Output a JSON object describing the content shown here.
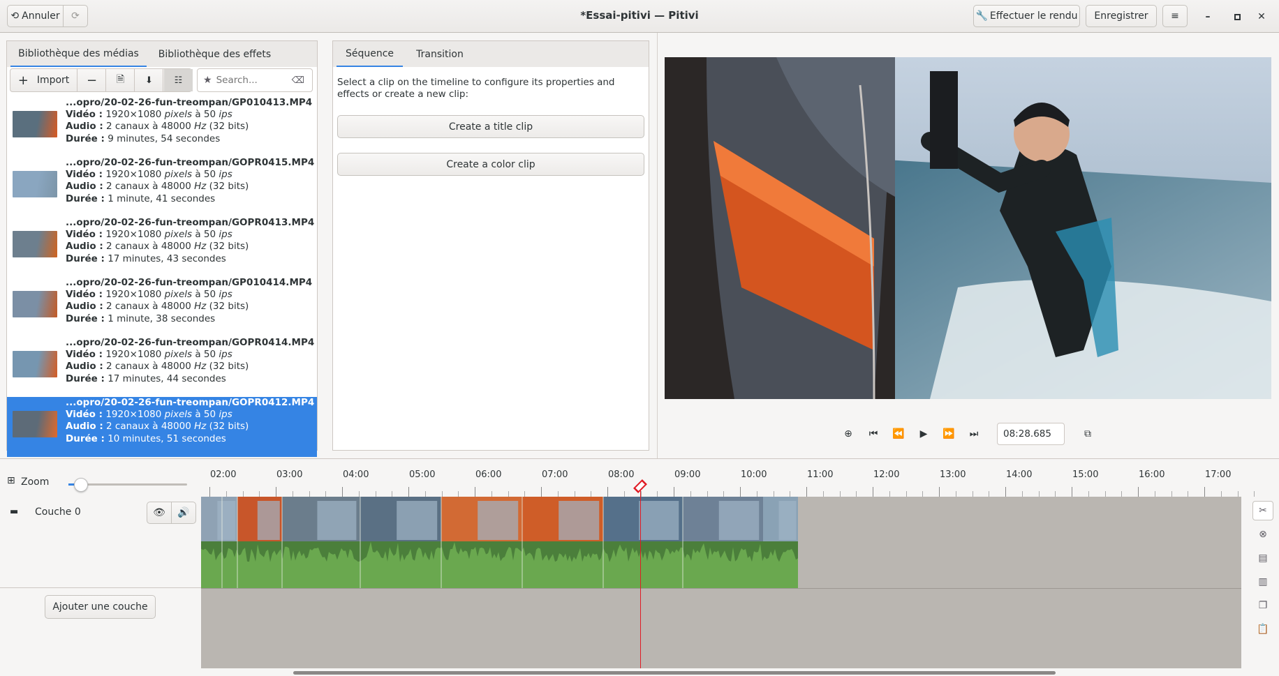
{
  "headerbar": {
    "undo_label": "Annuler",
    "title": "*Essai-pitivi — Pitivi",
    "render_label": "Effectuer le rendu",
    "save_label": "Enregistrer"
  },
  "library": {
    "tabs": [
      "Bibliothèque des médias",
      "Bibliothèque des effets"
    ],
    "import_label": "Import",
    "search_placeholder": "Search...",
    "items": [
      {
        "file": "...opro/20-02-26-fun-treompan/GP010413.MP4",
        "video_key": "Vidéo :",
        "video": "1920×1080",
        "video_unit": "pixels",
        "video_rate": "à 50",
        "video_rate_unit": "ips",
        "audio_key": "Audio :",
        "audio": "2 canaux à 48000",
        "audio_unit": "Hz",
        "audio_bits": "(32 bits)",
        "duration_key": "Durée :",
        "duration": "9 minutes, 54 secondes"
      },
      {
        "file": "...opro/20-02-26-fun-treompan/GOPR0415.MP4",
        "video_key": "Vidéo :",
        "video": "1920×1080",
        "video_unit": "pixels",
        "video_rate": "à 50",
        "video_rate_unit": "ips",
        "audio_key": "Audio :",
        "audio": "2 canaux à 48000",
        "audio_unit": "Hz",
        "audio_bits": "(32 bits)",
        "duration_key": "Durée :",
        "duration": "1 minute, 41 secondes"
      },
      {
        "file": "...opro/20-02-26-fun-treompan/GOPR0413.MP4",
        "video_key": "Vidéo :",
        "video": "1920×1080",
        "video_unit": "pixels",
        "video_rate": "à 50",
        "video_rate_unit": "ips",
        "audio_key": "Audio :",
        "audio": "2 canaux à 48000",
        "audio_unit": "Hz",
        "audio_bits": "(32 bits)",
        "duration_key": "Durée :",
        "duration": "17 minutes, 43 secondes"
      },
      {
        "file": "...opro/20-02-26-fun-treompan/GP010414.MP4",
        "video_key": "Vidéo :",
        "video": "1920×1080",
        "video_unit": "pixels",
        "video_rate": "à 50",
        "video_rate_unit": "ips",
        "audio_key": "Audio :",
        "audio": "2 canaux à 48000",
        "audio_unit": "Hz",
        "audio_bits": "(32 bits)",
        "duration_key": "Durée :",
        "duration": "1 minute, 38 secondes"
      },
      {
        "file": "...opro/20-02-26-fun-treompan/GOPR0414.MP4",
        "video_key": "Vidéo :",
        "video": "1920×1080",
        "video_unit": "pixels",
        "video_rate": "à 50",
        "video_rate_unit": "ips",
        "audio_key": "Audio :",
        "audio": "2 canaux à 48000",
        "audio_unit": "Hz",
        "audio_bits": "(32 bits)",
        "duration_key": "Durée :",
        "duration": "17 minutes, 44 secondes"
      },
      {
        "file": "...opro/20-02-26-fun-treompan/GOPR0412.MP4",
        "video_key": "Vidéo :",
        "video": "1920×1080",
        "video_unit": "pixels",
        "video_rate": "à 50",
        "video_rate_unit": "ips",
        "audio_key": "Audio :",
        "audio": "2 canaux à 48000",
        "audio_unit": "Hz",
        "audio_bits": "(32 bits)",
        "duration_key": "Durée :",
        "duration": "10 minutes, 51 secondes"
      }
    ]
  },
  "clip_panel": {
    "tabs": [
      "Séquence",
      "Transition"
    ],
    "hint": "Select a clip on the timeline to configure its properties and effects or create a new clip:",
    "title_clip_label": "Create a title clip",
    "color_clip_label": "Create a color clip"
  },
  "viewer": {
    "timecode": "08:28.685"
  },
  "timeline": {
    "zoom_label": "Zoom",
    "zoom_level": 0.08,
    "layer_name": "Couche 0",
    "add_layer_label": "Ajouter une couche",
    "ruler_labels": [
      "02:00",
      "03:00",
      "04:00",
      "05:00",
      "06:00",
      "07:00",
      "08:00",
      "09:00",
      "10:00",
      "11:00",
      "12:00",
      "13:00",
      "14:00",
      "15:00",
      "16:00",
      "17:00"
    ],
    "playhead_time": "08:28.685"
  },
  "colors": {
    "accent": "#3584e4",
    "audio_wave": "#6aa84f",
    "playhead": "#e01b24",
    "timeline_bg": "#bab6b1"
  }
}
